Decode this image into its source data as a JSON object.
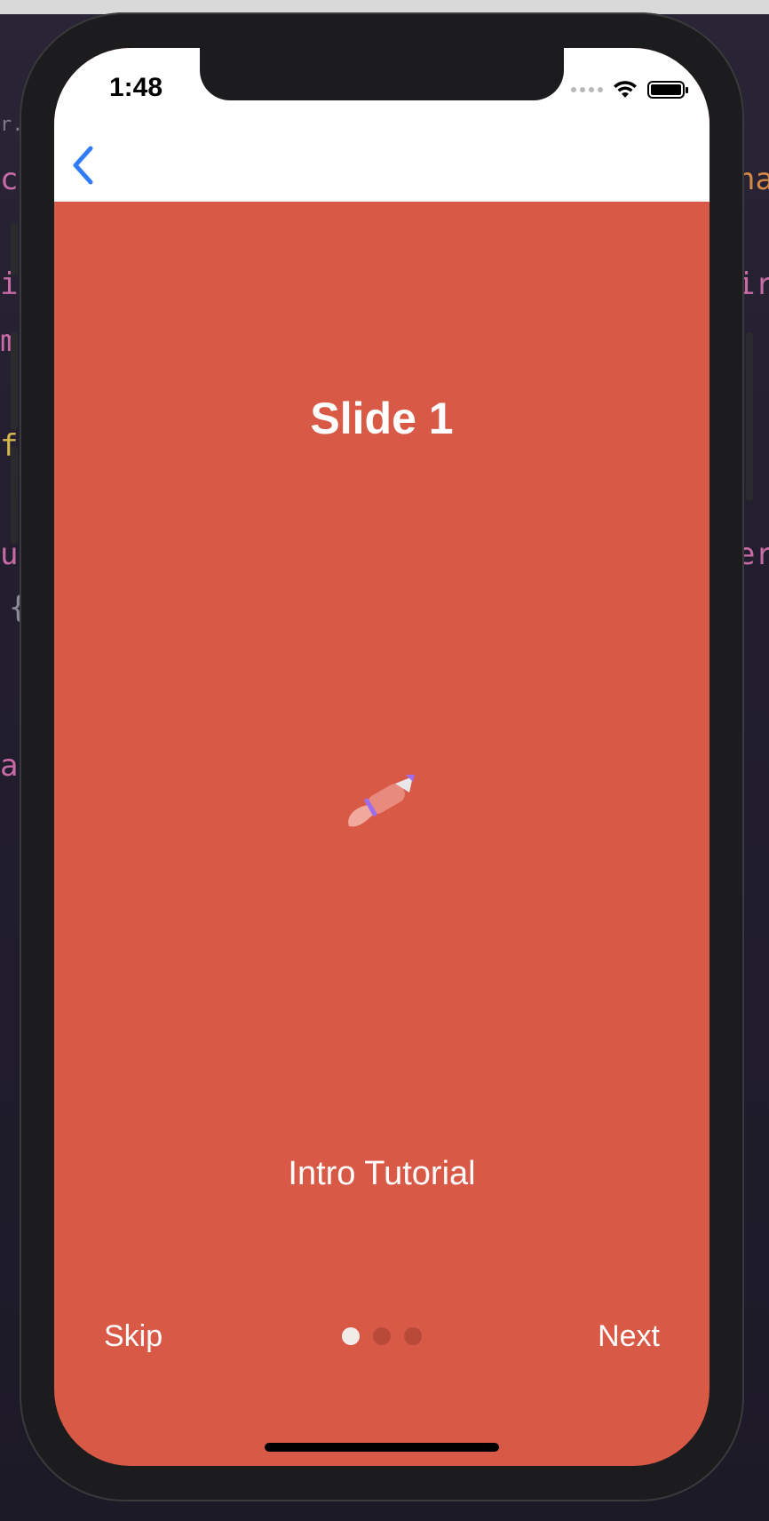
{
  "status_bar": {
    "time": "1:48"
  },
  "nav": {
    "back_icon": "chevron-left-icon"
  },
  "slide": {
    "title": "Slide 1",
    "image_icon": "rocket-icon",
    "text": "Intro Tutorial",
    "background_color": "#d85946"
  },
  "footer": {
    "skip_label": "Skip",
    "next_label": "Next",
    "pagination": {
      "total": 3,
      "active_index": 0
    }
  },
  "colors": {
    "accent_blue": "#2f7cf6",
    "dot_active": "#f2ece9",
    "dot_inactive": "#b94a3a"
  }
}
